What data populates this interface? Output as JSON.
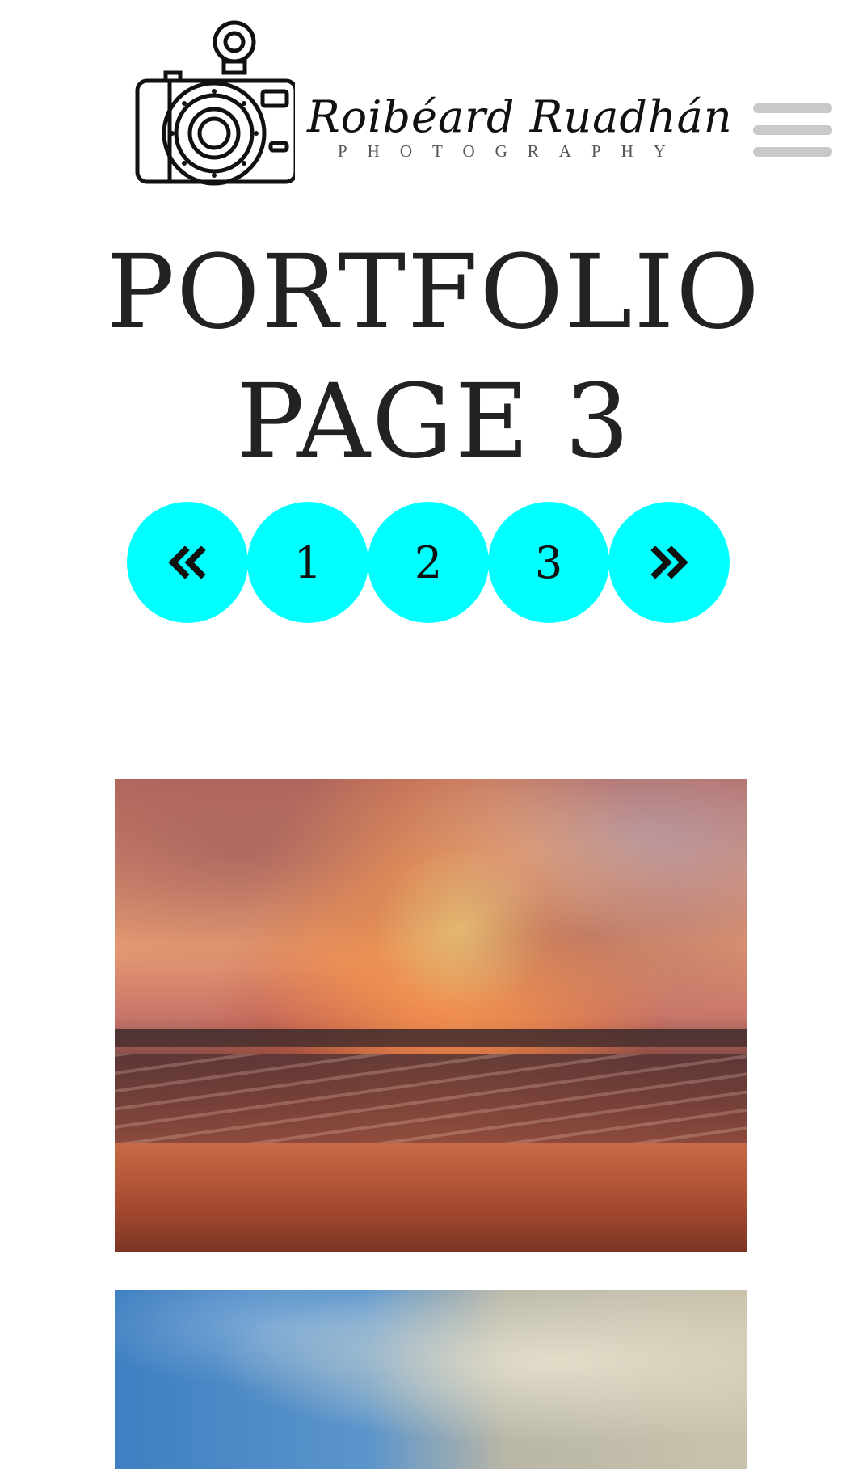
{
  "header": {
    "logo_name": "Roibéard Ruadhán",
    "logo_subtitle": "PHOTOGRAPHY"
  },
  "page": {
    "title_line1": "PORTFOLIO",
    "title_line2": "PAGE 3"
  },
  "pagination": {
    "items": [
      {
        "label": "«",
        "icon": "double-chevron-left-icon"
      },
      {
        "label": "1"
      },
      {
        "label": "2"
      },
      {
        "label": "3"
      },
      {
        "label": "»",
        "icon": "double-chevron-right-icon"
      }
    ],
    "accent_color": "#00ffff"
  },
  "gallery": {
    "images": [
      {
        "subject": "sunset-beach-photo"
      },
      {
        "subject": "sky-clouds-photo"
      }
    ]
  },
  "colors": {
    "background": "#ffffff",
    "hamburger": "#c9c9c9",
    "text": "#222222"
  }
}
